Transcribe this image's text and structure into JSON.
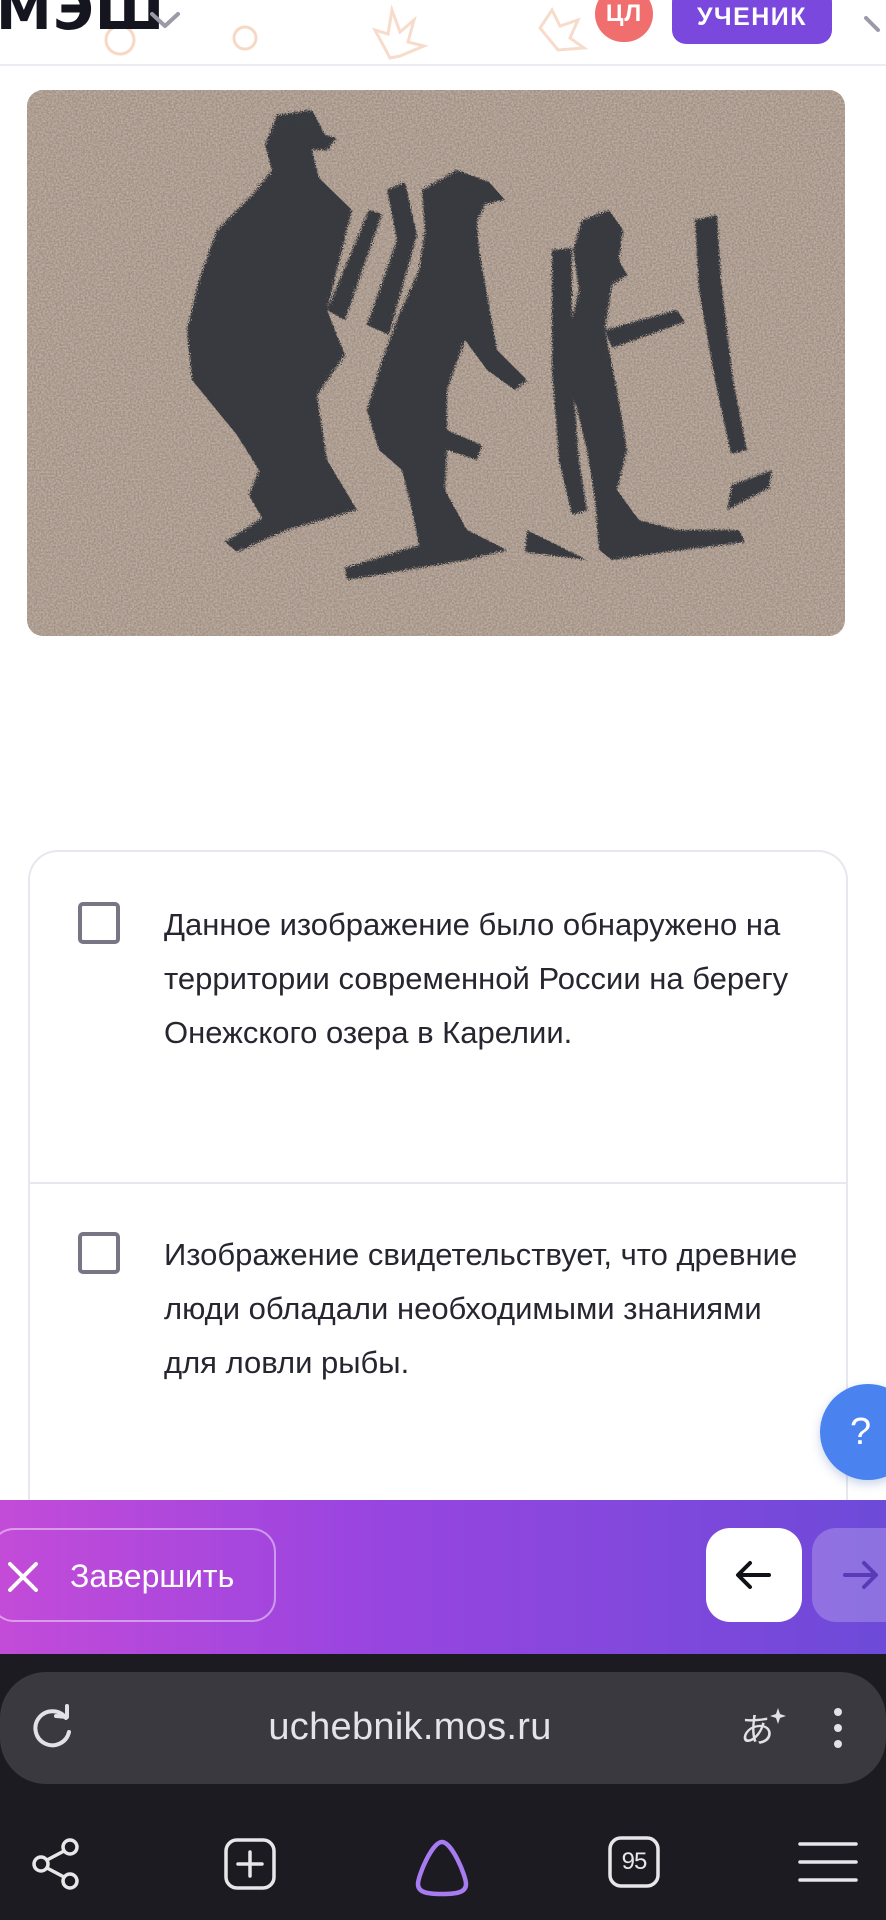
{
  "header": {
    "logo": "МЭШ",
    "badge": "ЦЛ",
    "role_button": "УЧЕНИК"
  },
  "picture": {
    "description_icon": "petroglyph-image"
  },
  "options": [
    {
      "checked": false,
      "text": "Данное изображение было обнаружено на территории современной России на берегу Онежского озера в Карелии."
    },
    {
      "checked": false,
      "text": "Изображение свидетельствует, что древние люди обладали необходимыми знаниями для ловли рыбы."
    }
  ],
  "help_button": "?",
  "action_bar": {
    "finish_label": "Завершить"
  },
  "browser": {
    "url": "uchebnik.mos.ru",
    "tabs_count": "95"
  },
  "colors": {
    "accent": "#7b48de",
    "badge": "#f06e6e",
    "help": "#4a83f0",
    "gradient_start": "#c34bd8",
    "gradient_end": "#6d4ad9"
  }
}
